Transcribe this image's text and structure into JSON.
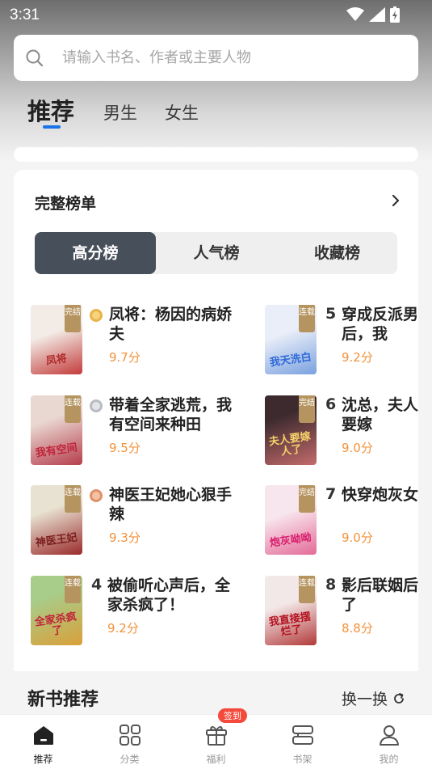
{
  "status_bar": {
    "time": "3:31"
  },
  "search": {
    "placeholder": "请输入书名、作者或主要人物"
  },
  "tabs": [
    {
      "label": "推荐",
      "active": true
    },
    {
      "label": "男生",
      "active": false
    },
    {
      "label": "女生",
      "active": false
    }
  ],
  "ranking": {
    "title": "完整榜单",
    "segments": [
      {
        "label": "高分榜",
        "active": true
      },
      {
        "label": "人气榜",
        "active": false
      },
      {
        "label": "收藏榜",
        "active": false
      }
    ],
    "books": [
      {
        "rank": "1",
        "name": "凤将：杨因的病娇夫",
        "score": "9.7分",
        "status": "完结",
        "cover_title": "凤将",
        "cover_colors": [
          "#f3ece6",
          "#c23b3b"
        ]
      },
      {
        "rank": "2",
        "name": "带着全家逃荒，我有空间来种田",
        "score": "9.5分",
        "status": "连载",
        "cover_title": "我有空间",
        "cover_colors": [
          "#e9d7d1",
          "#b63d4b"
        ]
      },
      {
        "rank": "3",
        "name": "神医王妃她心狠手辣",
        "score": "9.3分",
        "status": "连载",
        "cover_title": "神医王妃",
        "cover_colors": [
          "#e8e2d2",
          "#9a2b2b"
        ]
      },
      {
        "rank": "4",
        "name": "被偷听心声后，全家杀疯了！",
        "score": "9.2分",
        "status": "连载",
        "cover_title": "全家杀疯了",
        "cover_colors": [
          "#a8cc8a",
          "#d9a03a"
        ]
      },
      {
        "rank": "5",
        "name": "穿成反派男主前妻后，我",
        "score": "9.2分",
        "status": "连载",
        "cover_title": "我天洗白",
        "cover_colors": [
          "#e9eef8",
          "#7aa1df"
        ]
      },
      {
        "rank": "6",
        "name": "沈总，夫人的孩子要嫁",
        "score": "9.0分",
        "status": "完结",
        "cover_title": "夫人要嫁人了",
        "cover_colors": [
          "#3c2a2e",
          "#c46b6b"
        ]
      },
      {
        "rank": "7",
        "name": "快穿炮灰女配打脸",
        "score": "9.0分",
        "status": "完结",
        "cover_title": "炮灰呦呦",
        "cover_colors": [
          "#f8e6ee",
          "#e36b97"
        ]
      },
      {
        "rank": "8",
        "name": "影后联姻后接摆烂了",
        "score": "8.8分",
        "status": "连载",
        "cover_title": "我直接摆烂了",
        "cover_colors": [
          "#f3e8e8",
          "#b23a3a"
        ]
      }
    ]
  },
  "new_books": {
    "title": "新书推荐",
    "refresh_label": "换一换"
  },
  "bottom_nav": [
    {
      "label": "推荐",
      "icon": "home-icon",
      "active": true
    },
    {
      "label": "分类",
      "icon": "category-icon",
      "active": false
    },
    {
      "label": "福利",
      "icon": "gift-icon",
      "active": false,
      "badge": "签到"
    },
    {
      "label": "书架",
      "icon": "bookshelf-icon",
      "active": false
    },
    {
      "label": "我的",
      "icon": "profile-icon",
      "active": false
    }
  ],
  "colors": {
    "accent_blue": "#1a73e8",
    "score_orange": "#f2923b",
    "segment_active": "#474f5b",
    "badge_red": "#f4493b"
  }
}
